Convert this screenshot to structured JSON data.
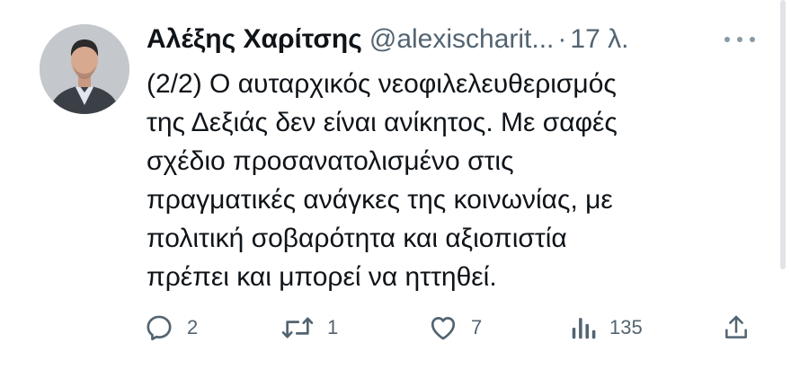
{
  "tweet": {
    "display_name": "Αλέξης Χαρίτσης",
    "handle": "@alexischarit...",
    "separator": "·",
    "time": "17 λ.",
    "text_lines": [
      "(2/2) Ο αυταρχικός νεοφιλελευθερισμός",
      "της Δεξιάς δεν είναι ανίκητος. Με σαφές",
      "σχέδιο προσανατολισμένο στις",
      "πραγματικές ανάγκες της κοινωνίας, με",
      "πολιτική σοβαρότητα και αξιοπιστία",
      "πρέπει και μπορεί να ηττηθεί."
    ]
  },
  "actions": {
    "reply": {
      "icon": "reply-icon",
      "count": "2"
    },
    "retweet": {
      "icon": "retweet-icon",
      "count": "1"
    },
    "like": {
      "icon": "heart-icon",
      "count": "7"
    },
    "views": {
      "icon": "views-icon",
      "count": "135"
    },
    "share": {
      "icon": "share-icon"
    }
  },
  "colors": {
    "text_primary": "#0f1419",
    "text_secondary": "#536471",
    "background": "#ffffff"
  }
}
